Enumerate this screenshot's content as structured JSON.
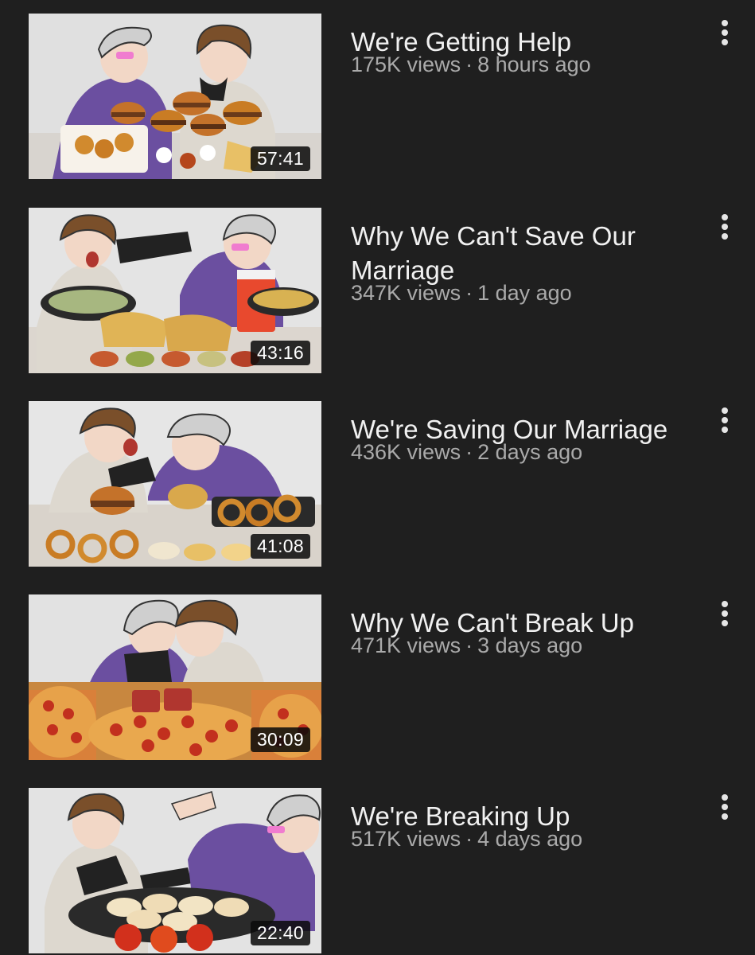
{
  "videos": [
    {
      "title": "We're Getting Help",
      "views": "175K views",
      "age": "8 hours ago",
      "duration": "57:41",
      "thumb_food": "burgers-and-nuggets"
    },
    {
      "title": "Why We Can't Save Our Marriage",
      "views": "347K views",
      "age": "1 day ago",
      "duration": "43:16",
      "thumb_food": "tacos-and-salsa"
    },
    {
      "title": "We're Saving Our Marriage",
      "views": "436K views",
      "age": "2 days ago",
      "duration": "41:08",
      "thumb_food": "burgers-and-onion-rings"
    },
    {
      "title": "Why We Can't Break Up",
      "views": "471K views",
      "age": "3 days ago",
      "duration": "30:09",
      "thumb_food": "pepperoni-pizza"
    },
    {
      "title": "We're Breaking Up",
      "views": "517K views",
      "age": "4 days ago",
      "duration": "22:40",
      "thumb_food": "dumplings-and-sauce"
    }
  ],
  "separator": "·",
  "icons": {
    "more": "more-vertical-icon"
  }
}
